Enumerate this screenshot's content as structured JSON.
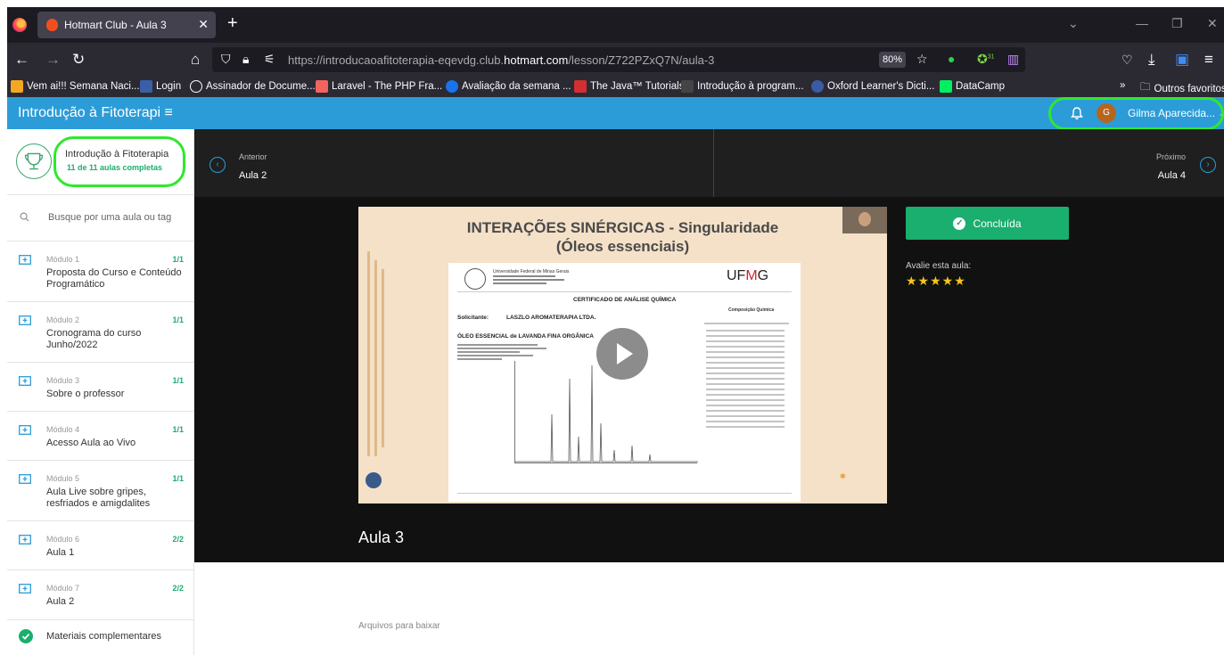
{
  "browser": {
    "tab_title": "Hotmart Club - Aula 3",
    "url_prefix": "https://introducaoafitoterapia-eqevdg.club.",
    "url_domain": "hotmart.com",
    "url_path": "/lesson/Z722PZxQ7N/aula-3",
    "zoom": "80%",
    "bookmarks": [
      {
        "label": "Vem ai!!! Semana Naci...",
        "icon_color": "#f5a623"
      },
      {
        "label": "Login",
        "icon_color": "#3a5fa8"
      },
      {
        "label": "Assinador de Docume...",
        "icon_color": "#666666"
      },
      {
        "label": "Laravel - The PHP Fra...",
        "icon_color": "#f4645f"
      },
      {
        "label": "Avaliação da semana ...",
        "icon_color": "#1a73e8"
      },
      {
        "label": "The Java™ Tutorials",
        "icon_color": "#d23030"
      },
      {
        "label": "Introdução à program...",
        "icon_color": "#444444"
      },
      {
        "label": "Oxford Learner's Dicti...",
        "icon_color": "#3b5ba5"
      },
      {
        "label": "DataCamp",
        "icon_color": "#03ef62"
      }
    ],
    "other_bookmarks": "Outros favoritos",
    "extension_badge": "31"
  },
  "header": {
    "course_title": "Introdução à Fitoterapi",
    "user_initial": "G",
    "user_name": "Gilma Aparecida..."
  },
  "sidebar": {
    "progress_title": "Introdução à Fitoterapia",
    "progress_sub": "11 de 11 aulas completas",
    "search_placeholder": "Busque por uma aula ou tag",
    "modules": [
      {
        "label": "Módulo 1",
        "count": "1/1",
        "name": "Proposta do Curso e Conteúdo Programático"
      },
      {
        "label": "Módulo 2",
        "count": "1/1",
        "name": "Cronograma do curso Junho/2022"
      },
      {
        "label": "Módulo 3",
        "count": "1/1",
        "name": "Sobre o professor"
      },
      {
        "label": "Módulo 4",
        "count": "1/1",
        "name": "Acesso Aula ao Vivo"
      },
      {
        "label": "Módulo 5",
        "count": "1/1",
        "name": "Aula Live sobre gripes, resfriados e amigdalites"
      },
      {
        "label": "Módulo 6",
        "count": "2/2",
        "name": "Aula 1"
      },
      {
        "label": "Módulo 7",
        "count": "2/2",
        "name": "Aula 2"
      }
    ],
    "materials": "Materiais complementares"
  },
  "lesson_nav": {
    "prev_small": "Anterior",
    "prev_name": "Aula 2",
    "next_small": "Próximo",
    "next_name": "Aula 4"
  },
  "video": {
    "slide_title_line1": "INTERAÇÕES SINÉRGICAS - Singularidade",
    "slide_title_line2": "(Óleos essenciais)",
    "cert_title": "CERTIFICADO DE ANÁLISE QUÍMICA",
    "cert_university": "Universidade Federal de Minas Gerais",
    "cert_requester_label": "Solicitante:",
    "cert_requester": "LASZLO AROMATERAPIA LTDA.",
    "cert_product": "ÓLEO ESSENCIAL  de  LAVANDA  FINA  ORGÂNICA",
    "cert_composition": "Composição Química",
    "logo_text": "UFMG"
  },
  "actions": {
    "done_label": "Concluída",
    "rate_label": "Avalie esta aula:",
    "stars": "★★★★★",
    "rating": 5
  },
  "lesson_title": "Aula 3",
  "files_label": "Arquivos para baixar"
}
